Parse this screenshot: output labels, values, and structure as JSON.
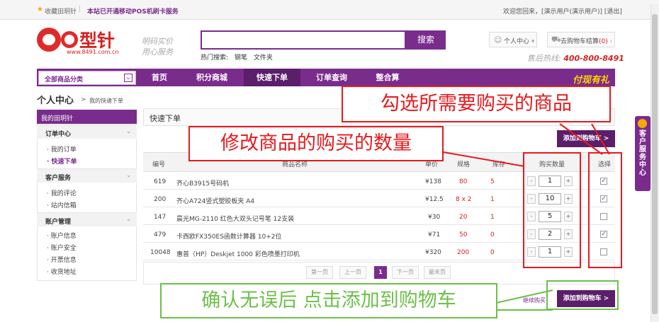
{
  "topbar": {
    "fav_label": "收藏田玥针",
    "sep": "|",
    "notice": "本站已开通移动POS机刷卡服务",
    "welcome": "欢迎您回来，[演示用户(演示用户)] [退出]"
  },
  "header": {
    "logo_text": "型针",
    "logo_url": "www.8491.com.cn",
    "slogan_line1": "明码实价",
    "slogan_line2": "用心服务",
    "search_value": "",
    "search_button": "搜索",
    "hot_label": "热门搜索:",
    "hot_keywords": [
      "钢笔",
      "文件夹"
    ],
    "user_center": "个人中心",
    "cart_label": "去购物车结算",
    "cart_count": "(0)",
    "hotline_label": "售后热线:",
    "hotline_number": "400-800-8491"
  },
  "nav": {
    "category_all": "全部商品分类",
    "items": [
      "首页",
      "积分商城",
      "快速下单",
      "订单查询",
      "整合算"
    ],
    "active_index": 2,
    "promo": "付现有礼"
  },
  "breadcrumb": {
    "title": "个人中心",
    "sep": ">",
    "current": "我的快速下单"
  },
  "sidebar": {
    "head": "我的田玥针",
    "sections": [
      {
        "title": "订单中心",
        "items": [
          "· 我的订单",
          "· 快速下单"
        ]
      },
      {
        "title": "客户服务",
        "items": [
          "· 我的评论",
          "· 站内信箱"
        ]
      },
      {
        "title": "账户管理",
        "items": [
          "· 账户信息",
          "· 账户安全",
          "· 开票信息",
          "· 收货地址"
        ]
      }
    ],
    "chevron": "⌄"
  },
  "main": {
    "title": "快速下单",
    "add_to_cart": "添加到购物车 >",
    "add_to_cart_partial": "添加到购物车 >",
    "continue_shopping": "继续购买",
    "headers": {
      "no": "编号",
      "name": "商品名称",
      "price": "单价",
      "spec": "规格",
      "stock": "库存",
      "qty": "购买数量",
      "select": "选择"
    },
    "rows": [
      {
        "no": "619",
        "name": "齐心B3915号码机",
        "price": "¥138",
        "spec": "80",
        "stock": "5",
        "qty": "1",
        "checked": true
      },
      {
        "no": "200",
        "name": "齐心A724竖式塑胶板夹 A4",
        "price": "¥12.5",
        "spec": "8 x 2",
        "stock": "1",
        "qty": "10",
        "checked": true
      },
      {
        "no": "147",
        "name": "晨光MG-2110 红色大双头记号笔 12支装",
        "price": "¥30",
        "spec": "20",
        "stock": "1",
        "qty": "5",
        "checked": false
      },
      {
        "no": "479",
        "name": "卡西欧FX350ES函数计算器 10+2位",
        "price": "¥71",
        "spec": "50",
        "stock": "0",
        "qty": "2",
        "checked": true
      },
      {
        "no": "10048",
        "name": "惠普（HP）Deskjet 1000 彩色喷墨打印机",
        "price": "¥320",
        "spec": "200",
        "stock": "0",
        "qty": "1",
        "checked": false
      }
    ],
    "minus": "-",
    "plus": "+",
    "check_mark": "✓",
    "pager": {
      "first": "第一页",
      "prev": "上一页",
      "current": "1",
      "next": "下一页",
      "last": "最末页"
    }
  },
  "annotations": {
    "select_goods": "勾选所需要购买的商品",
    "change_qty": "修改商品的购买的数量",
    "confirm_add": "确认无误后  点击添加到购物车"
  },
  "side_tab": "客户服务中心",
  "colors": {
    "brand_purple": "#7a2c8c",
    "annotation_red": "#e8191d",
    "annotation_green": "#6cc04a",
    "price_red": "#d72020"
  }
}
